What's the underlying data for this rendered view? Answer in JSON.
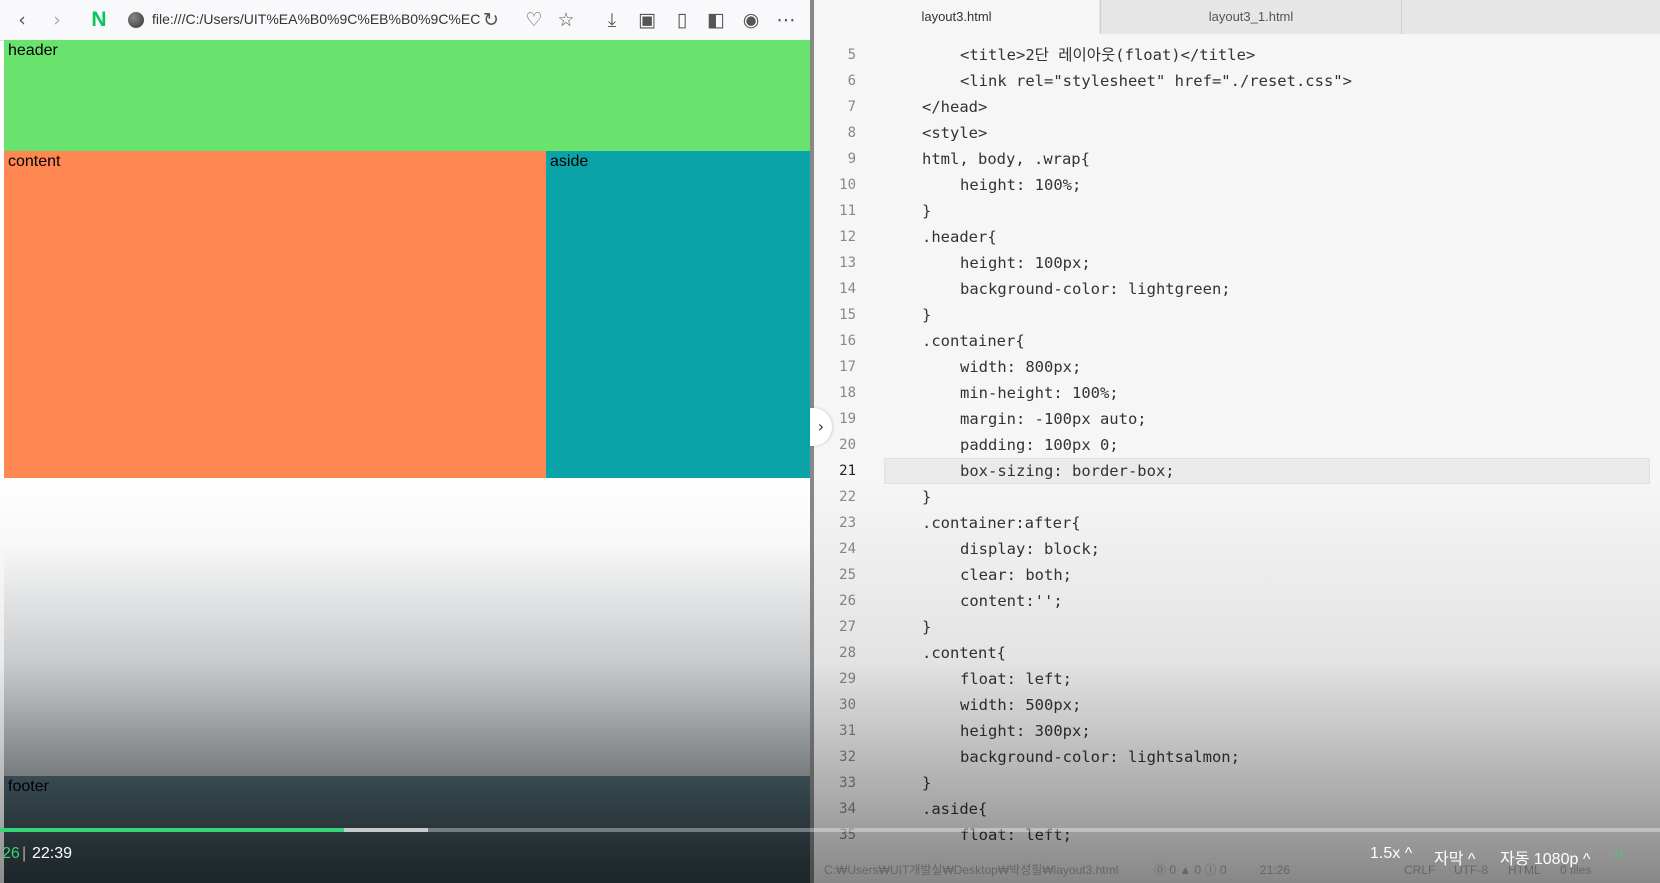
{
  "browser": {
    "url": "file:///C:/Users/UIT%EA%B0%9C%EB%B0%9C%EC",
    "naver_label": "N",
    "icons": [
      "back-icon",
      "forward-icon",
      "reload-icon",
      "pocket-icon",
      "star-icon",
      "download-icon",
      "screenshot-icon",
      "reader-icon",
      "sidebar-icon",
      "account-icon",
      "more-icon"
    ]
  },
  "page": {
    "header_label": "header",
    "content_label": "content",
    "aside_label": "aside",
    "footer_label": "footer",
    "colors": {
      "header": "#69e36d",
      "content": "#fe8752",
      "aside": "#09a3a8",
      "footer": "#4e6670"
    }
  },
  "editor": {
    "tabs": [
      {
        "label": "layout3.html",
        "active": true
      },
      {
        "label": "layout3_1.html",
        "active": false
      }
    ],
    "active_line": "21",
    "lines": [
      {
        "n": "5",
        "t": "<title>2단 레이아웃(float)</title>",
        "i": 1
      },
      {
        "n": "6",
        "t": "<link rel=\"stylesheet\" href=\"./reset.css\">",
        "i": 1
      },
      {
        "n": "7",
        "t": "</head>",
        "i": 0
      },
      {
        "n": "8",
        "t": "<style>",
        "i": 0
      },
      {
        "n": "9",
        "t": "html, body, .wrap{",
        "i": 0
      },
      {
        "n": "10",
        "t": "height: 100%;",
        "i": 1
      },
      {
        "n": "11",
        "t": "}",
        "i": 0
      },
      {
        "n": "12",
        "t": ".header{",
        "i": 0
      },
      {
        "n": "13",
        "t": "height: 100px;",
        "i": 1
      },
      {
        "n": "14",
        "t": "background-color: lightgreen;",
        "i": 1
      },
      {
        "n": "15",
        "t": "}",
        "i": 0
      },
      {
        "n": "16",
        "t": ".container{",
        "i": 0
      },
      {
        "n": "17",
        "t": "width: 800px;",
        "i": 1
      },
      {
        "n": "18",
        "t": "min-height: 100%;",
        "i": 1
      },
      {
        "n": "19",
        "t": "margin: -100px auto;",
        "i": 1
      },
      {
        "n": "20",
        "t": "padding: 100px 0;",
        "i": 1
      },
      {
        "n": "21",
        "t": "box-sizing: border-box;",
        "i": 1
      },
      {
        "n": "22",
        "t": "}",
        "i": 0
      },
      {
        "n": "23",
        "t": ".container:after{",
        "i": 0
      },
      {
        "n": "24",
        "t": "display: block;",
        "i": 1
      },
      {
        "n": "25",
        "t": "clear: both;",
        "i": 1
      },
      {
        "n": "26",
        "t": "content:'';",
        "i": 1
      },
      {
        "n": "27",
        "t": "}",
        "i": 0
      },
      {
        "n": "28",
        "t": ".content{",
        "i": 0
      },
      {
        "n": "29",
        "t": "float: left;",
        "i": 1
      },
      {
        "n": "30",
        "t": "width: 500px;",
        "i": 1
      },
      {
        "n": "31",
        "t": "height: 300px;",
        "i": 1
      },
      {
        "n": "32",
        "t": "background-color: lightsalmon;",
        "i": 1
      },
      {
        "n": "33",
        "t": "}",
        "i": 0
      },
      {
        "n": "34",
        "t": ".aside{",
        "i": 0
      },
      {
        "n": "35",
        "t": "float: left;",
        "i": 1
      }
    ],
    "status": {
      "path": "C:₩Users₩UIT개발실₩Desktop₩박성필₩layout3.html",
      "problems": "⓪ 0 ▲ 0 ⓘ 0",
      "position": "21:26",
      "eol": "CRLF",
      "encoding": "UTF-8",
      "language": "HTML",
      "files": "0 files"
    }
  },
  "player": {
    "time_prefix": "26",
    "time": "22:39",
    "speed": "1.5x ^",
    "subtitle": "자막 ^",
    "quality": "자동 1080p ^",
    "progress": 0.207,
    "buffered": 0.258,
    "accent": "#37d47a"
  }
}
